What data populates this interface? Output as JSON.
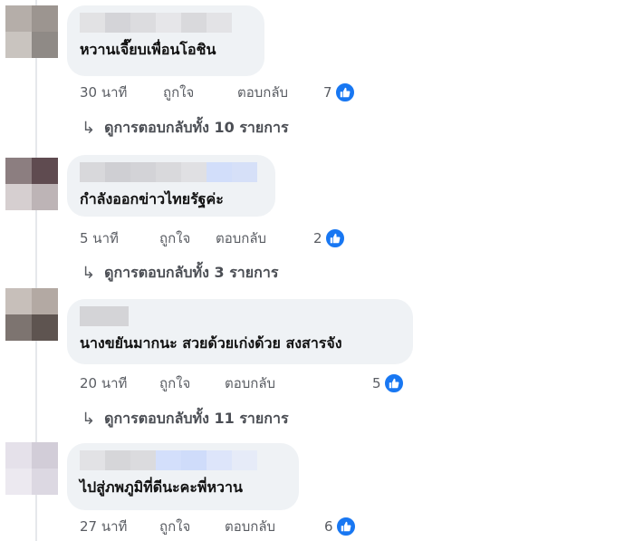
{
  "comments": [
    {
      "text": "หวานเจี๊ยบเพื่อนโอชิน",
      "time": "30 นาที",
      "like_label": "ถูกใจ",
      "reply_label": "ตอบกลับ",
      "reaction_count": "7",
      "view_replies": "ดูการตอบกลับทั้ง 10 รายการ"
    },
    {
      "text": "กำลังออกข่าวไทยรัฐค่ะ",
      "time": "5 นาที",
      "like_label": "ถูกใจ",
      "reply_label": "ตอบกลับ",
      "reaction_count": "2",
      "view_replies": "ดูการตอบกลับทั้ง 3 รายการ"
    },
    {
      "text": "นางขยันมากนะ สวยด้วยเก่งด้วย สงสารจัง",
      "time": "20 นาที",
      "like_label": "ถูกใจ",
      "reply_label": "ตอบกลับ",
      "reaction_count": "5",
      "view_replies": "ดูการตอบกลับทั้ง 11 รายการ"
    },
    {
      "text": "ไปสู่ภพภูมิที่ดีนะคะพี่หวาน",
      "time": "27 นาที",
      "like_label": "ถูกใจ",
      "reply_label": "ตอบกลับ",
      "reaction_count": "6"
    }
  ],
  "colors": {
    "bubble": "#eff2f5",
    "like_blue": "#1877f2",
    "meta_text": "#5a5d63"
  },
  "icons": {
    "reaction": "thumbs-up-icon",
    "reply_arrow": "reply-arrow-icon"
  }
}
